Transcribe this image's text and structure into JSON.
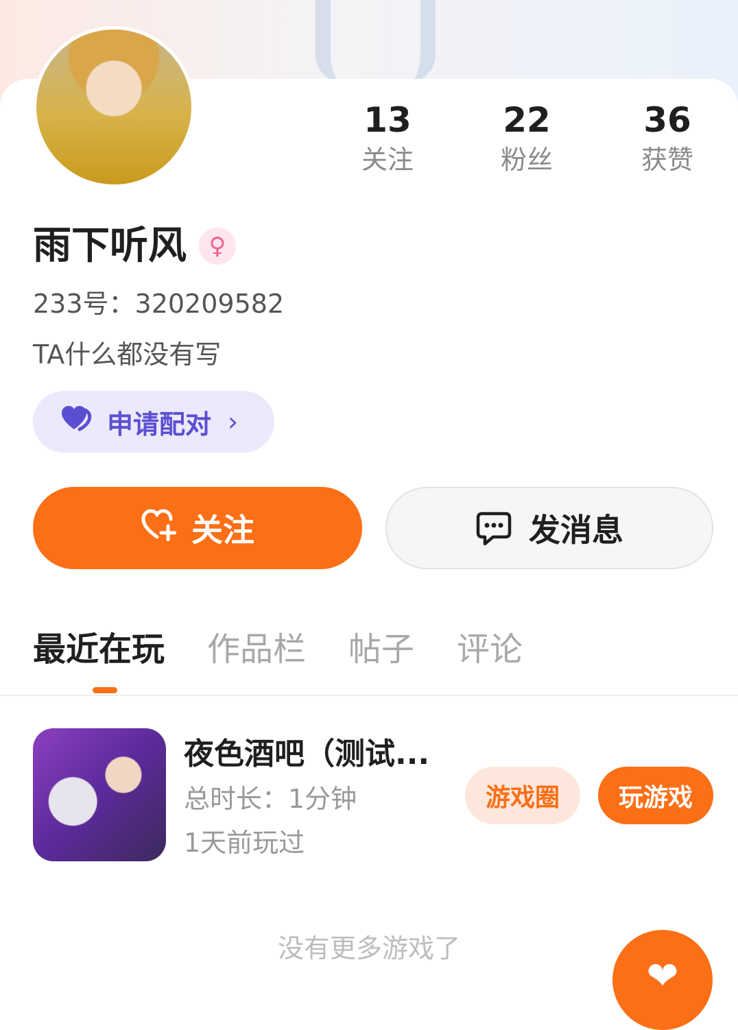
{
  "profile": {
    "name": "雨下听风",
    "gender_icon": "♀",
    "user_id": "233号：320209582",
    "bio": "TA什么都没有写"
  },
  "stats": [
    {
      "value": "13",
      "label": "关注"
    },
    {
      "value": "22",
      "label": "粉丝"
    },
    {
      "value": "36",
      "label": "获赞"
    }
  ],
  "pair": {
    "label": "申请配对",
    "icon": "heart-pair-icon",
    "chevron": "›"
  },
  "actions": {
    "follow_label": "关注",
    "follow_icon": "♡",
    "message_label": "发消息"
  },
  "tabs": [
    {
      "label": "最近在玩",
      "active": true
    },
    {
      "label": "作品栏",
      "active": false
    },
    {
      "label": "帖子",
      "active": false
    },
    {
      "label": "评论",
      "active": false
    }
  ],
  "games": [
    {
      "title": "夜色酒吧（测试...",
      "duration": "总时长：1分钟",
      "last_played": "1天前玩过",
      "circle_label": "游戏圈",
      "play_label": "玩游戏"
    }
  ],
  "footer": {
    "no_more": "没有更多游戏了"
  },
  "fab": {
    "icon": "❤"
  },
  "colors": {
    "accent": "#fb6f16",
    "pair_bg": "#ebe9fb",
    "pair_fg": "#5b4fd1",
    "gender_bg": "#fde6ef",
    "gender_fg": "#f0628a"
  }
}
